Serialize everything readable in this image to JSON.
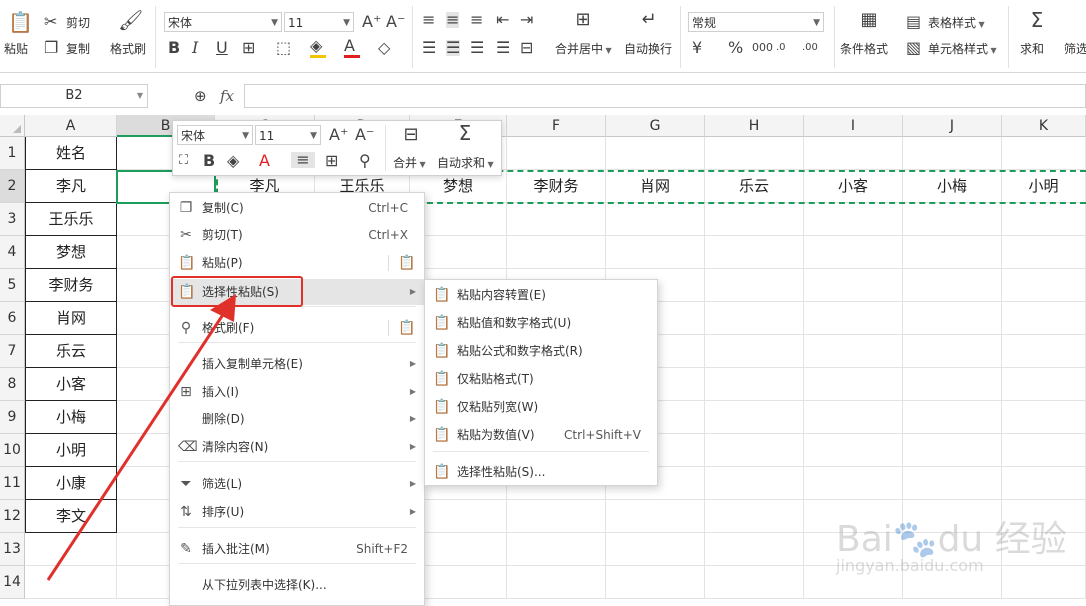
{
  "ribbon": {
    "paste": "粘贴",
    "cut": "剪切",
    "copy": "复制",
    "format_painter": "格式刷",
    "font_name": "宋体",
    "font_size": "11",
    "merge_center": "合并居中",
    "wrap_text": "自动换行",
    "number_format": "常规",
    "conditional_format": "条件格式",
    "table_style": "表格样式",
    "cell_style": "单元格样式",
    "sum": "求和",
    "filter": "筛选",
    "accent_color": "#1e9c5b",
    "font_color_bar": "#e02020",
    "fill_color_bar": "#f5c400"
  },
  "formula_bar": {
    "name_box": "B2",
    "fx": "fx",
    "value": ""
  },
  "columns": [
    "A",
    "B",
    "C",
    "D",
    "E",
    "F",
    "G",
    "H",
    "I",
    "J",
    "K"
  ],
  "rows": [
    "1",
    "2",
    "3",
    "4",
    "5",
    "6",
    "7",
    "8",
    "9",
    "10",
    "11",
    "12",
    "13",
    "14"
  ],
  "column_a": [
    "姓名",
    "李凡",
    "王乐乐",
    "梦想",
    "李财务",
    "肖网",
    "乐云",
    "小客",
    "小梅",
    "小明",
    "小康",
    "李文"
  ],
  "row2_values": [
    "李凡",
    "王乐乐",
    "梦想",
    "李财务",
    "肖网",
    "乐云",
    "小客",
    "小梅",
    "小明"
  ],
  "mini_toolbar": {
    "font_name": "宋体",
    "font_size": "11",
    "merge": "合并",
    "autosum": "自动求和"
  },
  "context_menu": [
    {
      "label": "复制(C)",
      "shortcut": "Ctrl+C"
    },
    {
      "label": "剪切(T)",
      "shortcut": "Ctrl+X"
    },
    {
      "label": "粘贴(P)",
      "shortcut": ""
    },
    {
      "label": "选择性粘贴(S)",
      "shortcut": ""
    },
    {
      "label": "格式刷(F)",
      "shortcut": ""
    },
    {
      "label": "插入复制单元格(E)",
      "shortcut": ""
    },
    {
      "label": "插入(I)",
      "shortcut": ""
    },
    {
      "label": "删除(D)",
      "shortcut": ""
    },
    {
      "label": "清除内容(N)",
      "shortcut": ""
    },
    {
      "label": "筛选(L)",
      "shortcut": ""
    },
    {
      "label": "排序(U)",
      "shortcut": ""
    },
    {
      "label": "插入批注(M)",
      "shortcut": "Shift+F2"
    },
    {
      "label": "从下拉列表中选择(K)...",
      "shortcut": ""
    }
  ],
  "submenu": [
    {
      "label": "粘贴内容转置(E)",
      "shortcut": ""
    },
    {
      "label": "粘贴值和数字格式(U)",
      "shortcut": ""
    },
    {
      "label": "粘贴公式和数字格式(R)",
      "shortcut": ""
    },
    {
      "label": "仅粘贴格式(T)",
      "shortcut": ""
    },
    {
      "label": "仅粘贴列宽(W)",
      "shortcut": ""
    },
    {
      "label": "粘贴为数值(V)",
      "shortcut": "Ctrl+Shift+V"
    },
    {
      "label": "选择性粘贴(S)...",
      "shortcut": ""
    }
  ],
  "watermark": "Baidu经验 jingyan.baidu.com",
  "highlight_color": "#e0302a"
}
